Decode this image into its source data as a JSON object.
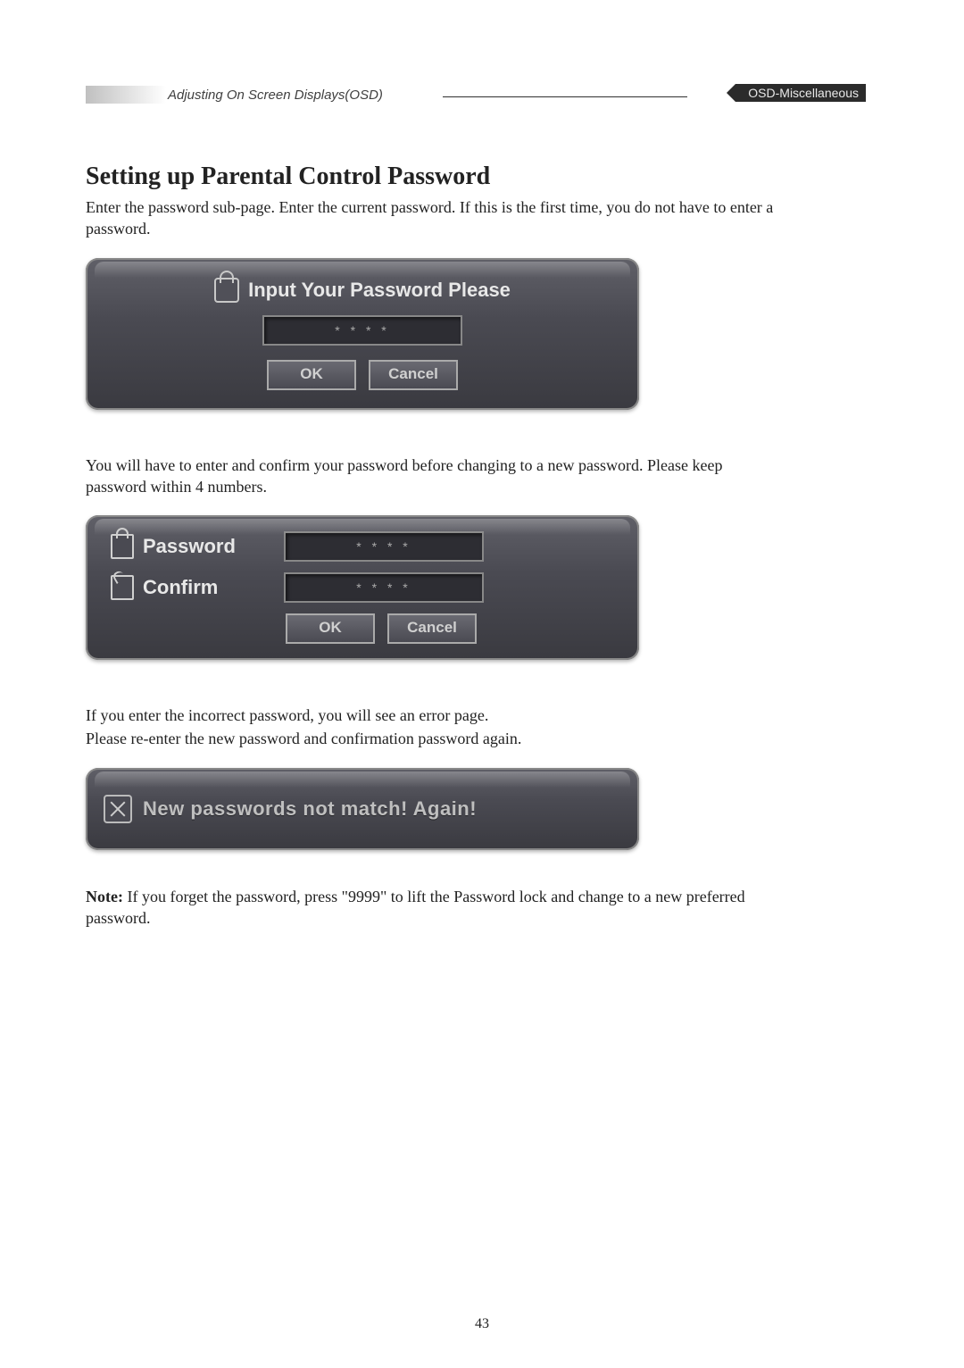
{
  "header": {
    "breadcrumb": "Adjusting On Screen Displays(OSD)",
    "badge": "OSD-Miscellaneous"
  },
  "section": {
    "heading": "Setting up Parental Control Password",
    "intro": "Enter the password sub-page. Enter the current password. If this is the first time, you do not have to enter a password.",
    "para2": "You will have to enter and confirm your password before changing to a new password. Please keep password within 4 numbers.",
    "para3a": "If you enter the incorrect password, you will see an error page.",
    "para3b": "Please re-enter the new password and confirmation password again.",
    "note_label": "Note:",
    "note_text": " If you forget the password, press \"9999\" to lift the Password lock and change to a new preferred password."
  },
  "osd1": {
    "title": "Input Your Password Please",
    "input_mask": "* * * *",
    "ok": "OK",
    "cancel": "Cancel"
  },
  "osd2": {
    "password_label": "Password",
    "confirm_label": "Confirm",
    "password_mask": "* * * *",
    "confirm_mask": "* * * *",
    "ok": "OK",
    "cancel": "Cancel"
  },
  "osd3": {
    "message": "New passwords not match! Again!"
  },
  "page_number": "43"
}
